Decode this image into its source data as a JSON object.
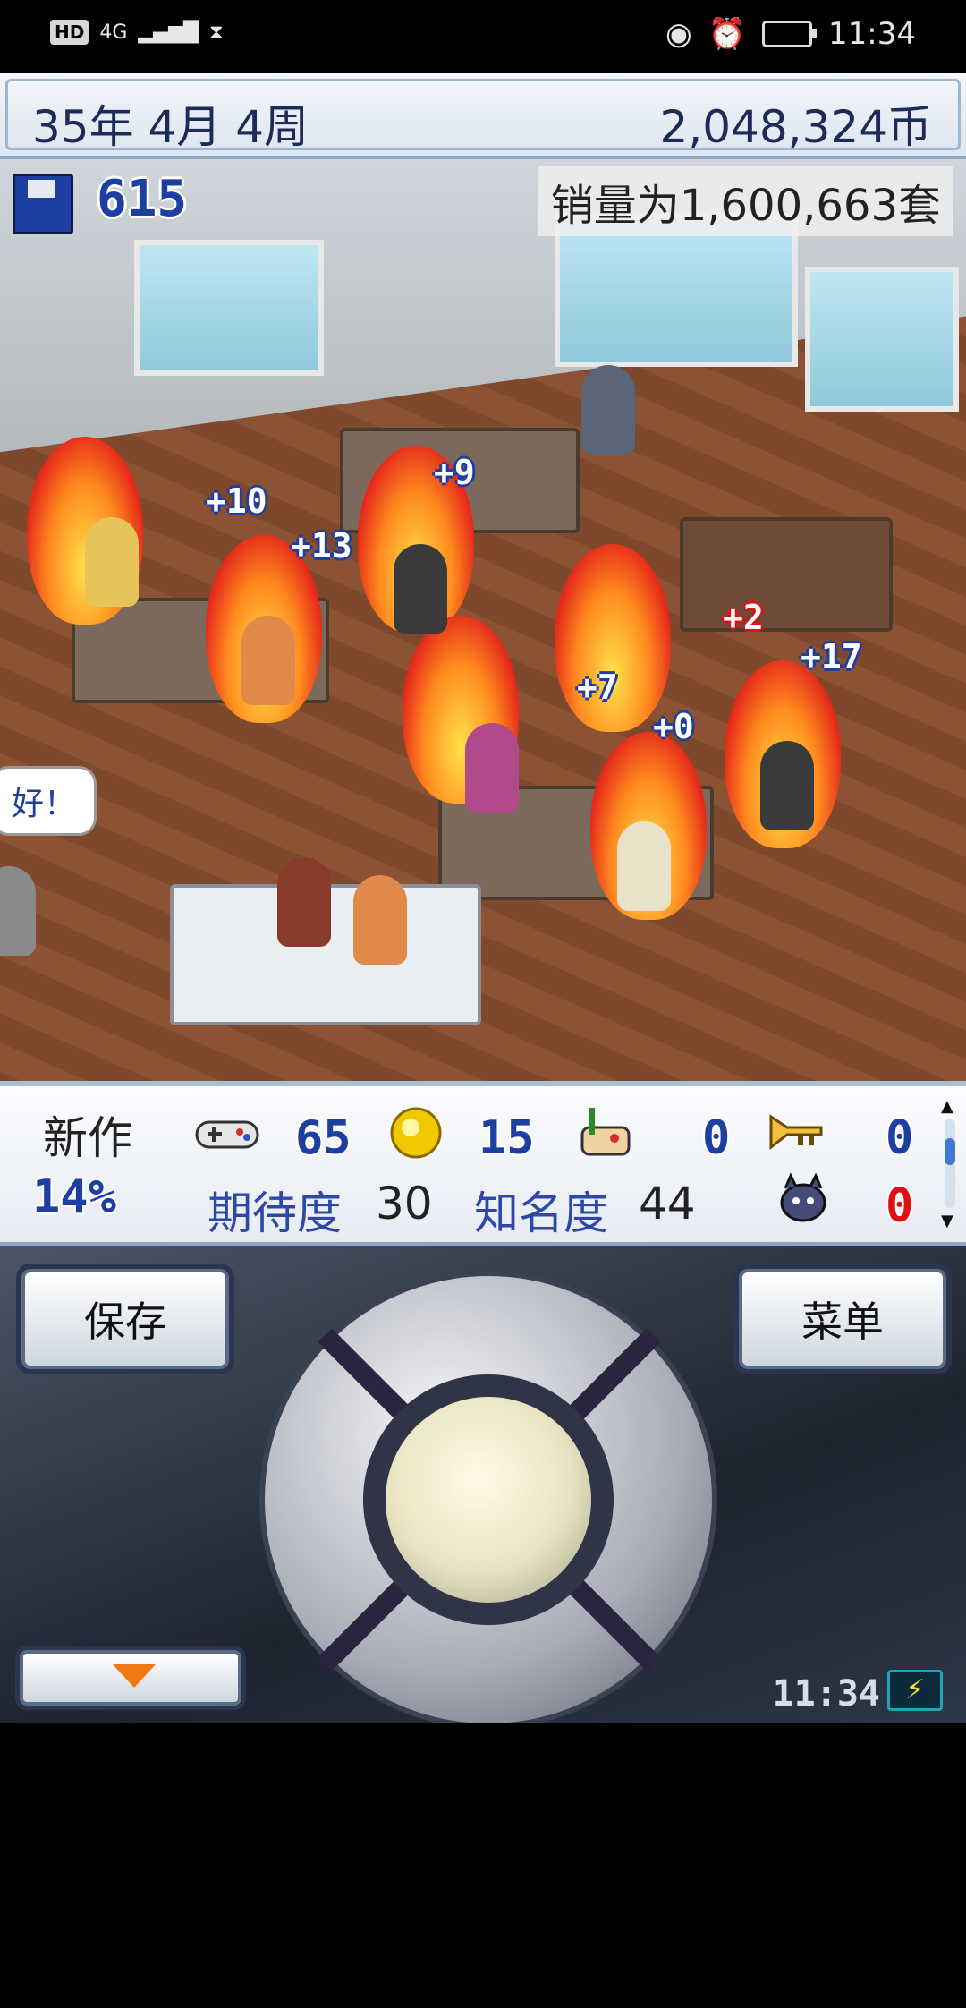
{
  "status_bar": {
    "indicators": [
      "HD",
      "4G"
    ],
    "time": "11:34"
  },
  "header": {
    "date": "35年 4月 4周",
    "money": "2,048,324币"
  },
  "scene": {
    "project_count": "615",
    "sales_text": "销量为1,600,663套",
    "speech": "好！",
    "popups": [
      "+10",
      "+13",
      "+9",
      "+7",
      "+0",
      "+2",
      "+17"
    ]
  },
  "stats": {
    "new_title_label": "新作",
    "progress": "14%",
    "fun_value": "65",
    "creativity_value": "15",
    "graphics_value": "0",
    "sound_value": "0",
    "bugs_value": "0",
    "expectation_label": "期待度",
    "expectation_value": "30",
    "fame_label": "知名度",
    "fame_value": "44"
  },
  "controls": {
    "save_label": "保存",
    "menu_label": "菜单",
    "clock": "11:34"
  },
  "colors": {
    "accent_blue": "#1e3fa2",
    "bug_red": "#e01010",
    "fire": "#ff8a1e"
  },
  "icons": [
    "floppy-icon",
    "gamepad-icon",
    "coin-icon",
    "paint-icon",
    "trumpet-icon",
    "bug-icon",
    "battery-icon",
    "alarm-icon",
    "eye-icon"
  ]
}
